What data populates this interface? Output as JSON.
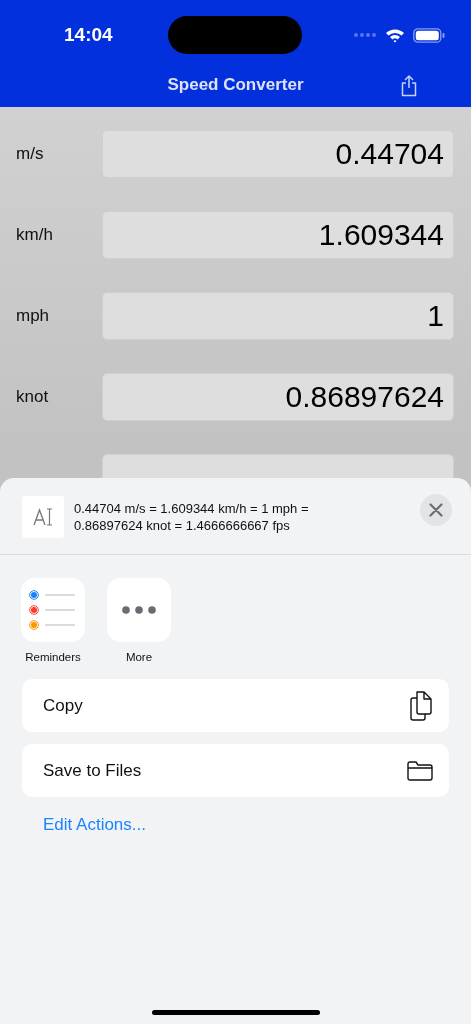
{
  "status_bar": {
    "time": "14:04"
  },
  "nav_bar": {
    "title": "Speed Converter"
  },
  "units": [
    {
      "label": "m/s",
      "value": "0.44704"
    },
    {
      "label": "km/h",
      "value": "1.609344"
    },
    {
      "label": "mph",
      "value": "1"
    },
    {
      "label": "knot",
      "value": "0.86897624"
    }
  ],
  "share_sheet": {
    "preview_text": "0.44704 m/s = 1.609344 km/h = 1 mph = 0.86897624 knot =  1.4666666667 fps",
    "apps": [
      {
        "kind": "reminders",
        "label": "Reminders"
      },
      {
        "kind": "more",
        "label": "More"
      }
    ],
    "actions": [
      {
        "kind": "copy",
        "label": "Copy"
      },
      {
        "kind": "files",
        "label": "Save to Files"
      }
    ],
    "edit_link": "Edit Actions..."
  }
}
